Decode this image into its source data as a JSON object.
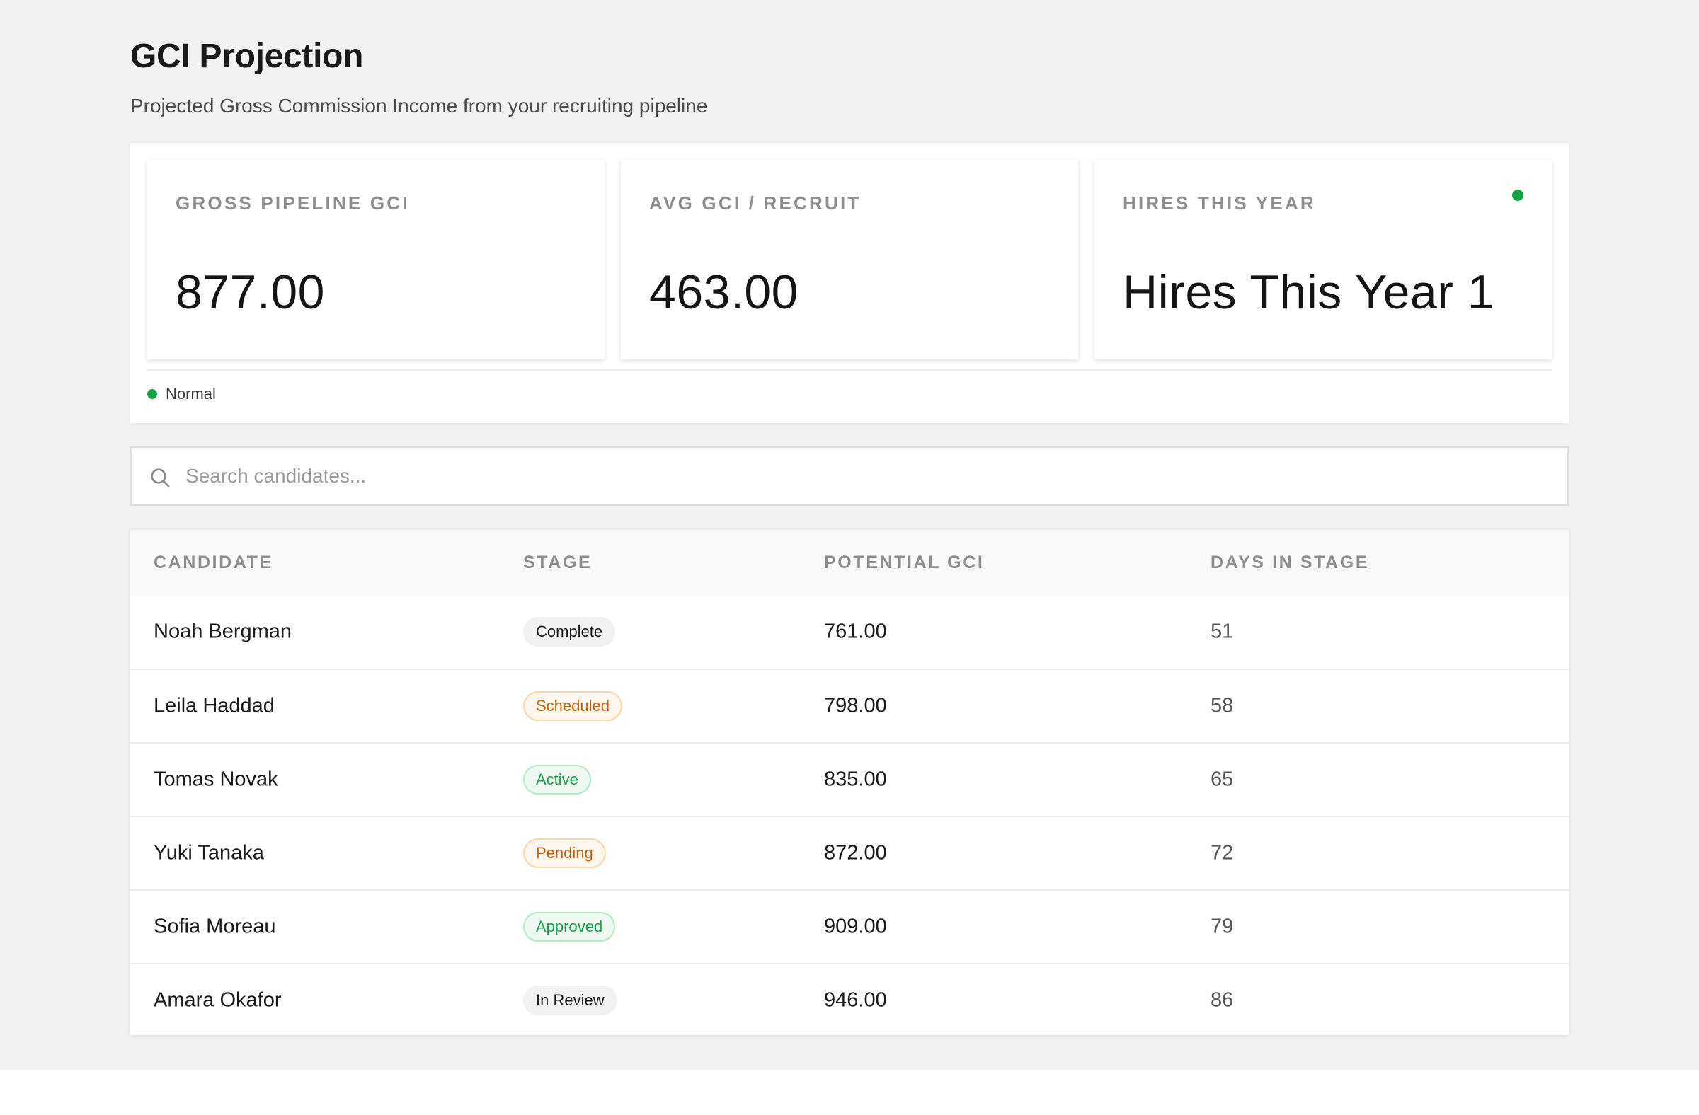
{
  "header": {
    "title": "GCI Projection",
    "subtitle": "Projected Gross Commission Income from your recruiting pipeline"
  },
  "metrics": [
    {
      "label": "GROSS PIPELINE GCI",
      "value": "877.00"
    },
    {
      "label": "AVG GCI / RECRUIT",
      "value": "463.00"
    },
    {
      "label": "HIRES THIS YEAR",
      "value": "Hires This Year 1"
    }
  ],
  "status": {
    "label": "Normal",
    "color": "#16a34a"
  },
  "search": {
    "placeholder": "Search candidates...",
    "icon": "search-icon"
  },
  "table": {
    "columns": [
      "CANDIDATE",
      "STAGE",
      "POTENTIAL GCI",
      "DAYS IN STAGE"
    ],
    "rows": [
      {
        "candidate": "Noah Bergman",
        "stage": "Complete",
        "stage_tone": "neutral",
        "gci": "761.00",
        "days": "51"
      },
      {
        "candidate": "Leila Haddad",
        "stage": "Scheduled",
        "stage_tone": "warning",
        "gci": "798.00",
        "days": "58"
      },
      {
        "candidate": "Tomas Novak",
        "stage": "Active",
        "stage_tone": "success",
        "gci": "835.00",
        "days": "65"
      },
      {
        "candidate": "Yuki Tanaka",
        "stage": "Pending",
        "stage_tone": "warning",
        "gci": "872.00",
        "days": "72"
      },
      {
        "candidate": "Sofia Moreau",
        "stage": "Approved",
        "stage_tone": "success",
        "gci": "909.00",
        "days": "79"
      },
      {
        "candidate": "Amara Okafor",
        "stage": "In Review",
        "stage_tone": "neutral",
        "gci": "946.00",
        "days": "86"
      }
    ]
  },
  "colors": {
    "accent_green": "#16a34a",
    "warning_orange": "#c2600e",
    "page_background": "#f2f2f2"
  }
}
